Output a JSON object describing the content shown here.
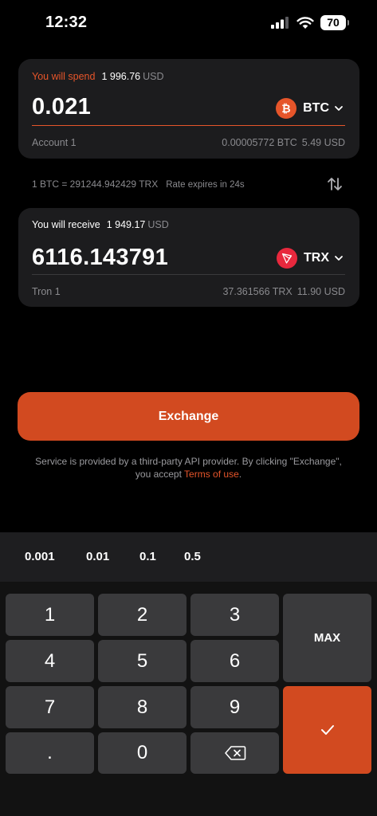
{
  "status_bar": {
    "time": "12:32",
    "battery": "70"
  },
  "spend": {
    "label": "You will spend",
    "fiat_amount": "1 996.76",
    "fiat_currency": "USD",
    "amount": "0.021",
    "currency": "BTC",
    "account": "Account 1",
    "balance_crypto": "0.00005772 BTC",
    "balance_fiat": "5.49 USD"
  },
  "rate": {
    "text": "1 BTC = 291244.942429 TRX",
    "expires": "Rate expires in 24s"
  },
  "receive": {
    "label": "You will receive",
    "fiat_amount": "1 949.17",
    "fiat_currency": "USD",
    "amount": "6116.143791",
    "currency": "TRX",
    "account": "Tron 1",
    "balance_crypto": "37.361566 TRX",
    "balance_fiat": "11.90 USD"
  },
  "exchange_button": "Exchange",
  "disclaimer": {
    "line1": "Service is provided by a third-party API provider. By clicking \"Exchange\",",
    "line2_prefix": "you accept ",
    "link": "Terms of use",
    "line2_suffix": "."
  },
  "presets": [
    "0.001",
    "0.01",
    "0.1",
    "0.5"
  ],
  "keys": {
    "k1": "1",
    "k2": "2",
    "k3": "3",
    "k4": "4",
    "k5": "5",
    "k6": "6",
    "k7": "7",
    "k8": "8",
    "k9": "9",
    "dot": ".",
    "k0": "0",
    "max": "MAX"
  },
  "colors": {
    "accent": "#d24a20",
    "btc": "#e6552a",
    "trx": "#e8283d",
    "card": "#1c1c1e"
  },
  "icons": {
    "btc": "bitcoin-icon",
    "trx": "tron-icon",
    "swap": "swap-arrows-icon",
    "backspace": "backspace-icon",
    "confirm": "checkmark-icon"
  }
}
